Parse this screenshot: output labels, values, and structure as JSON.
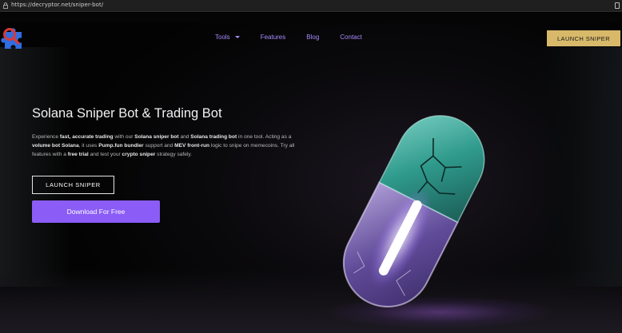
{
  "browser": {
    "url": "https://decryptor.net/sniper-bot/"
  },
  "nav": {
    "items": [
      {
        "label": "Tools",
        "has_dropdown": true
      },
      {
        "label": "Features"
      },
      {
        "label": "Blog"
      },
      {
        "label": "Contact"
      }
    ],
    "cta_label": "LAUNCH SNIPER"
  },
  "hero": {
    "title": "Solana Sniper Bot & Trading Bot",
    "description": {
      "p1": "Experience ",
      "b1": "fast, accurate trading",
      "p2": " with our ",
      "b2": "Solana sniper bot",
      "p3": " and ",
      "b3": "Solana trading bot",
      "p4": " in one tool. Acting as a ",
      "b4": "volume bot Solana",
      "p5": ", it uses ",
      "b5": "Pump.fun bundler",
      "p6": " support and ",
      "b6": "MEV front-run",
      "p7": " logic to snipe on memecoins. Try all features with a ",
      "b7": "free trial",
      "p8": " and test your ",
      "b8": "crypto sniper",
      "p9": " strategy safely."
    },
    "launch_label": "LAUNCH SNIPER",
    "download_label": "Download For Free"
  },
  "colors": {
    "accent": "#8b5cf6",
    "nav_link": "#a78bfa",
    "cta_gold": "#d8b96a"
  },
  "icons": {
    "logo": "puzzle-logo-icon",
    "lock": "lock-icon",
    "dropdown": "caret-down-icon"
  }
}
